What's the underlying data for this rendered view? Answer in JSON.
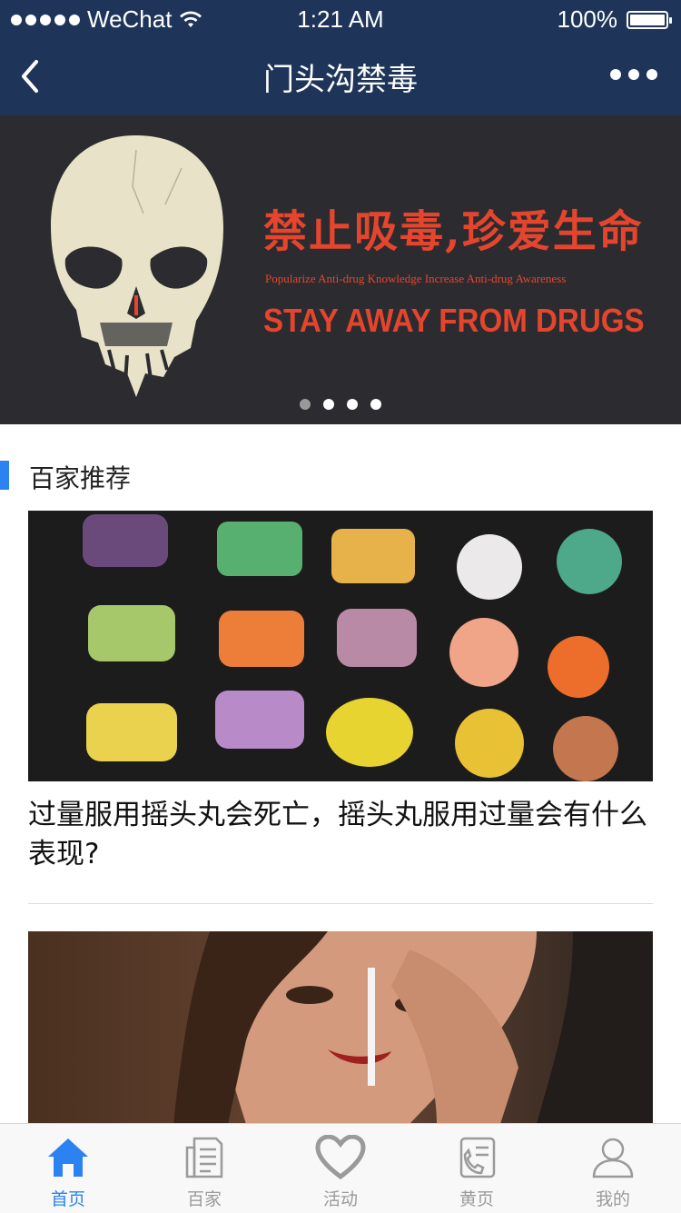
{
  "status_bar": {
    "carrier": "WeChat",
    "time": "1:21 AM",
    "battery": "100%",
    "battery_level": 1.0
  },
  "nav": {
    "title": "门头沟禁毒",
    "back_icon": "chevron-left-icon",
    "more_icon": "more-dots-icon"
  },
  "banner": {
    "headline": "禁止吸毒,珍爱生命",
    "subtitle": "Popularize Anti-drug Knowledge  Increase Anti-drug Awareness",
    "slogan": "STAY AWAY FROM DRUGS",
    "slide_count": 4,
    "active_slide": 1,
    "accent_color": "#e5452d"
  },
  "section": {
    "title": "百家推荐",
    "accent_color": "#2b82f0"
  },
  "articles": [
    {
      "title": "过量服用摇头丸会死亡，摇头丸服用过量会有什么表现?"
    },
    {
      "title": ""
    }
  ],
  "tabbar": {
    "items": [
      {
        "label": "首页",
        "icon": "home-icon",
        "active": true
      },
      {
        "label": "百家",
        "icon": "document-icon",
        "active": false
      },
      {
        "label": "活动",
        "icon": "heart-hands-icon",
        "active": false
      },
      {
        "label": "黄页",
        "icon": "phone-book-icon",
        "active": false
      },
      {
        "label": "我的",
        "icon": "user-icon",
        "active": false
      }
    ],
    "active_color": "#2b82f0",
    "inactive_color": "#9a9a9a"
  },
  "colors": {
    "navbar_bg": "#1e3559"
  }
}
